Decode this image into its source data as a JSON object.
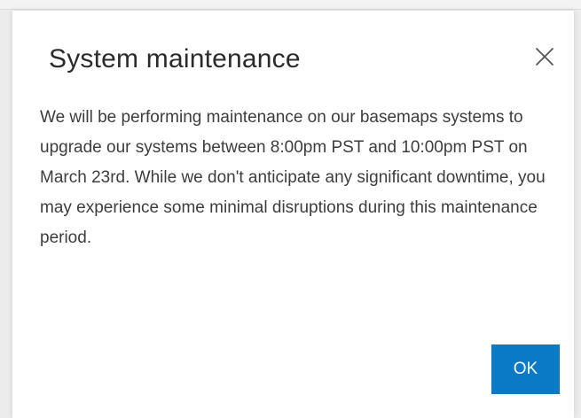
{
  "dialog": {
    "title": "System maintenance",
    "body": "We will be performing maintenance on our basemaps systems to upgrade our systems between 8:00pm PST and 10:00pm PST on March 23rd. While we don't anticipate any significant downtime, you may experience some minimal disruptions during this maintenance period.",
    "ok_label": "OK",
    "close_icon": "close-icon"
  },
  "colors": {
    "accent": "#0a79c6",
    "title_text": "#2b2b2b",
    "body_text": "#3d3d3d",
    "background": "#ffffff"
  }
}
